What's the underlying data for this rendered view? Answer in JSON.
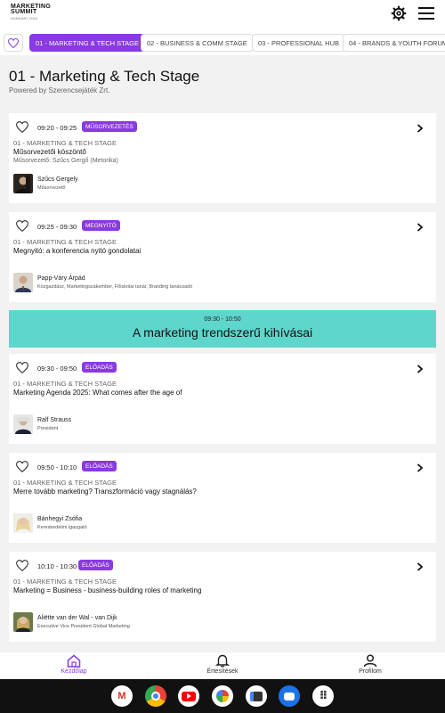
{
  "app": {
    "logo_line1": "MARKETING",
    "logo_line2": "SUMMIT",
    "logo_line3": "HUNGARY 2024"
  },
  "tabs": [
    {
      "label": "01 - MARKETING & TECH STAGE",
      "active": true
    },
    {
      "label": "02 - BUSINESS & COMM STAGE",
      "active": false
    },
    {
      "label": "03 - PROFESSIONAL HUB",
      "active": false
    },
    {
      "label": "04 - BRANDS & YOUTH FORUM",
      "active": false
    }
  ],
  "header": {
    "title": "01 - Marketing & Tech Stage",
    "subtitle": "Powered by Szerencsejáték Zrt."
  },
  "sessions": [
    {
      "time": "09:20 - 09:25",
      "badge": "MŰSORVEZETÉS",
      "stage": "01 - MARKETING & TECH STAGE",
      "title": "Műsorvezetői köszöntő",
      "host": "Műsorvezető: Szűcs Gergő (Metorika)",
      "speaker_name": "Szűcs Gergely",
      "speaker_role": "Műsorvezető"
    },
    {
      "time": "09:25 - 09:30",
      "badge": "MEGNYITÓ",
      "stage": "01 - MARKETING & TECH STAGE",
      "title": "Megnyitó: a konferencia nyitó gondolatai",
      "speaker_name": "Papp-Váry Árpád",
      "speaker_role": "Közgazdász, Marketingszakember, Főiskolai tanár, Branding tanácsadó"
    },
    {
      "time": "09:30 - 09:50",
      "badge": "ELŐADÁS",
      "stage": "01 - MARKETING & TECH STAGE",
      "title": "Marketing Agenda 2025: What comes after the age of",
      "speaker_name": "Ralf Strauss",
      "speaker_role": "President"
    },
    {
      "time": "09:50 - 10:10",
      "badge": "ELŐADÁS",
      "stage": "01 - MARKETING & TECH STAGE",
      "title": "Merre tovább marketing? Transzformáció vagy stagnálás?",
      "speaker_name": "Bánhegyi Zsófia",
      "speaker_role": "Kereskedelmi igazgató"
    },
    {
      "time": "10:10 - 10:30",
      "badge": "ELŐADÁS",
      "stage": "01 - MARKETING & TECH STAGE",
      "title": "Marketing = Business - business-building roles of marketing",
      "speaker_name": "Aliëtte van der Wal - van Dijk",
      "speaker_role": "Executive Vice President Global Marketing"
    }
  ],
  "block": {
    "time": "09:30 - 10:50",
    "title": "A marketing trendszerű kihívásai"
  },
  "bottom_nav": [
    {
      "label": "Kezdőlap",
      "icon": "home-icon",
      "active": true
    },
    {
      "label": "Értesítések",
      "icon": "bell-icon",
      "active": false
    },
    {
      "label": "Profilom",
      "icon": "user-icon",
      "active": false
    }
  ],
  "dock": [
    "gmail-icon",
    "chrome-icon",
    "youtube-icon",
    "photos-icon",
    "news-icon",
    "messages-icon",
    "apps-icon"
  ],
  "colors": {
    "accent": "#8a3ae0",
    "banner": "#5ed6cc"
  }
}
